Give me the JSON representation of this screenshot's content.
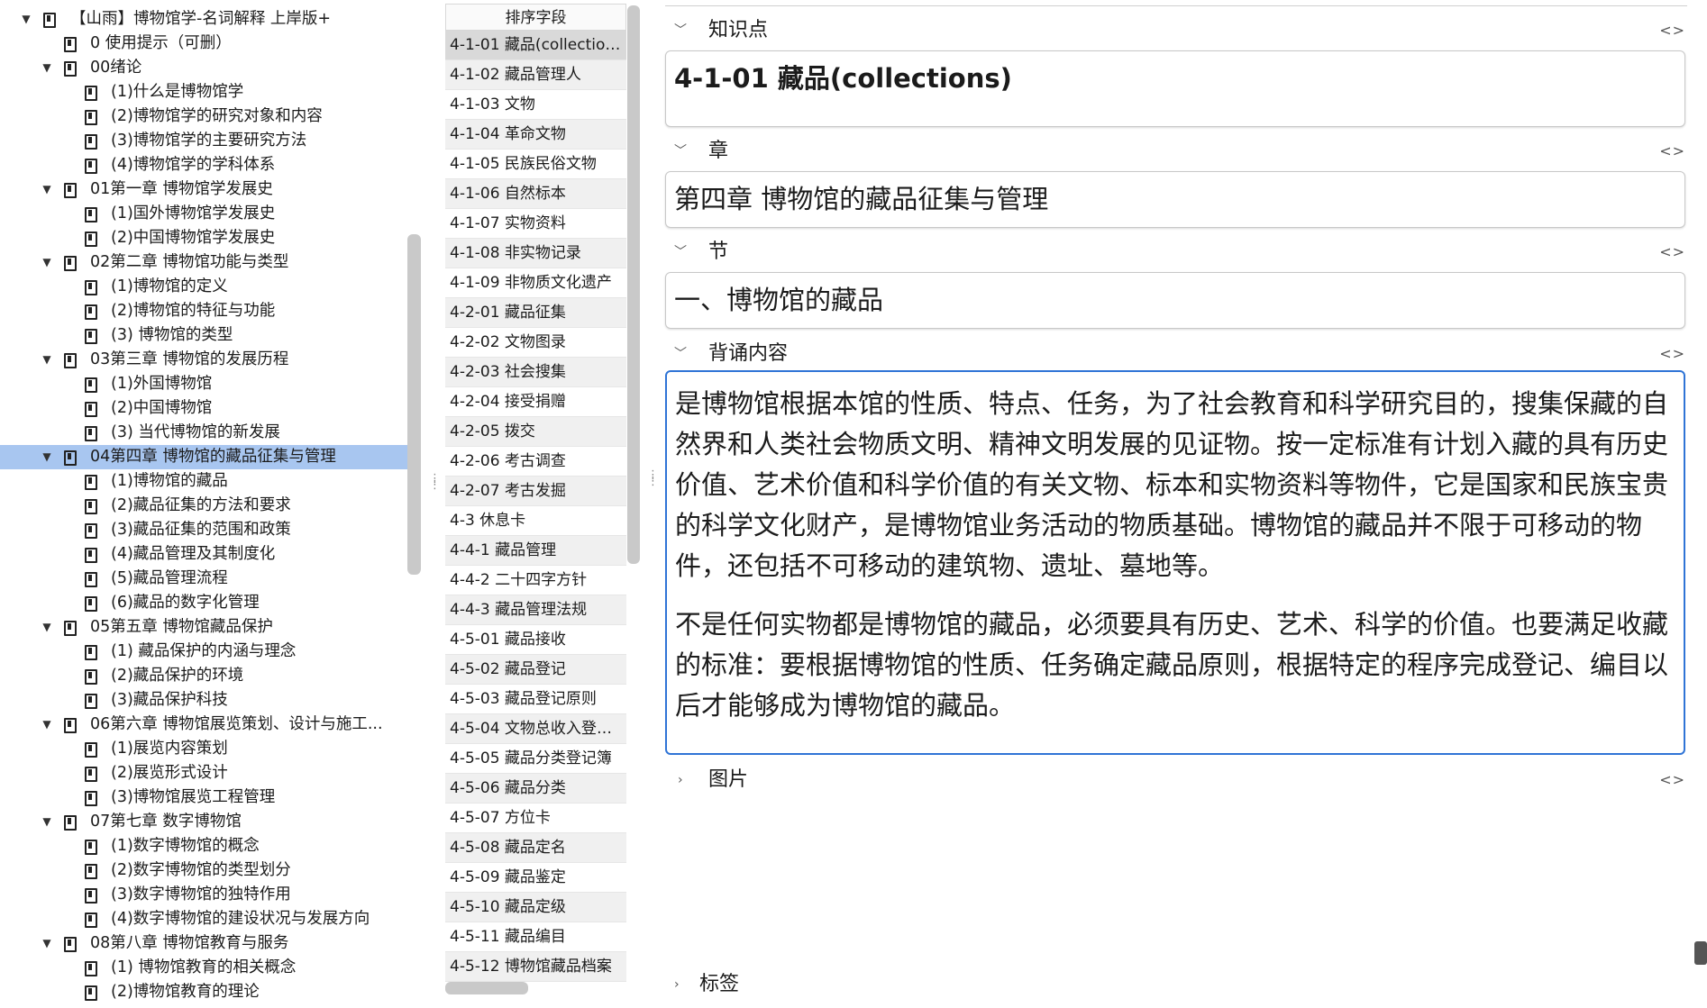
{
  "tree": {
    "items": [
      {
        "label": "【山雨】博物馆学-名词解释 上岸版+",
        "level": 0,
        "expanded": true,
        "selected": false
      },
      {
        "label": "0 使用提示（可删）",
        "level": 2,
        "expanded": null,
        "selected": false,
        "indent": 1
      },
      {
        "label": "00绪论",
        "level": 1,
        "expanded": true,
        "selected": false
      },
      {
        "label": "(1)什么是博物馆学",
        "level": 2,
        "expanded": null,
        "selected": false
      },
      {
        "label": "(2)博物馆学的研究对象和内容",
        "level": 2,
        "expanded": null,
        "selected": false
      },
      {
        "label": "(3)博物馆学的主要研究方法",
        "level": 2,
        "expanded": null,
        "selected": false
      },
      {
        "label": "(4)博物馆学的学科体系",
        "level": 2,
        "expanded": null,
        "selected": false
      },
      {
        "label": "01第一章 博物馆学发展史",
        "level": 1,
        "expanded": true,
        "selected": false
      },
      {
        "label": "(1)国外博物馆学发展史",
        "level": 2,
        "expanded": null,
        "selected": false
      },
      {
        "label": "(2)中国博物馆学发展史",
        "level": 2,
        "expanded": null,
        "selected": false
      },
      {
        "label": "02第二章 博物馆功能与类型",
        "level": 1,
        "expanded": true,
        "selected": false
      },
      {
        "label": "(1)博物馆的定义",
        "level": 2,
        "expanded": null,
        "selected": false
      },
      {
        "label": "(2)博物馆的特征与功能",
        "level": 2,
        "expanded": null,
        "selected": false
      },
      {
        "label": "(3) 博物馆的类型",
        "level": 2,
        "expanded": null,
        "selected": false
      },
      {
        "label": "03第三章 博物馆的发展历程",
        "level": 1,
        "expanded": true,
        "selected": false
      },
      {
        "label": "(1)外国博物馆",
        "level": 2,
        "expanded": null,
        "selected": false
      },
      {
        "label": "(2)中国博物馆",
        "level": 2,
        "expanded": null,
        "selected": false
      },
      {
        "label": "(3) 当代博物馆的新发展",
        "level": 2,
        "expanded": null,
        "selected": false
      },
      {
        "label": "04第四章 博物馆的藏品征集与管理",
        "level": 1,
        "expanded": true,
        "selected": true
      },
      {
        "label": "(1)博物馆的藏品",
        "level": 2,
        "expanded": null,
        "selected": false
      },
      {
        "label": "(2)藏品征集的方法和要求",
        "level": 2,
        "expanded": null,
        "selected": false
      },
      {
        "label": "(3)藏品征集的范围和政策",
        "level": 2,
        "expanded": null,
        "selected": false
      },
      {
        "label": "(4)藏品管理及其制度化",
        "level": 2,
        "expanded": null,
        "selected": false
      },
      {
        "label": "(5)藏品管理流程",
        "level": 2,
        "expanded": null,
        "selected": false
      },
      {
        "label": "(6)藏品的数字化管理",
        "level": 2,
        "expanded": null,
        "selected": false
      },
      {
        "label": "05第五章 博物馆藏品保护",
        "level": 1,
        "expanded": true,
        "selected": false
      },
      {
        "label": "(1) 藏品保护的内涵与理念",
        "level": 2,
        "expanded": null,
        "selected": false
      },
      {
        "label": "(2)藏品保护的环境",
        "level": 2,
        "expanded": null,
        "selected": false
      },
      {
        "label": "(3)藏品保护科技",
        "level": 2,
        "expanded": null,
        "selected": false
      },
      {
        "label": "06第六章 博物馆展览策划、设计与施工...",
        "level": 1,
        "expanded": true,
        "selected": false
      },
      {
        "label": "(1)展览内容策划",
        "level": 2,
        "expanded": null,
        "selected": false
      },
      {
        "label": "(2)展览形式设计",
        "level": 2,
        "expanded": null,
        "selected": false
      },
      {
        "label": "(3)博物馆展览工程管理",
        "level": 2,
        "expanded": null,
        "selected": false
      },
      {
        "label": "07第七章 数字博物馆",
        "level": 1,
        "expanded": true,
        "selected": false
      },
      {
        "label": "(1)数字博物馆的概念",
        "level": 2,
        "expanded": null,
        "selected": false
      },
      {
        "label": "(2)数字博物馆的类型划分",
        "level": 2,
        "expanded": null,
        "selected": false
      },
      {
        "label": "(3)数字博物馆的独特作用",
        "level": 2,
        "expanded": null,
        "selected": false
      },
      {
        "label": "(4)数字博物馆的建设状况与发展方向",
        "level": 2,
        "expanded": null,
        "selected": false
      },
      {
        "label": "08第八章 博物馆教育与服务",
        "level": 1,
        "expanded": true,
        "selected": false
      },
      {
        "label": "(1) 博物馆教育的相关概念",
        "level": 2,
        "expanded": null,
        "selected": false
      },
      {
        "label": "(2)博物馆教育的理论",
        "level": 2,
        "expanded": null,
        "selected": false
      }
    ]
  },
  "cards": {
    "header": "排序字段",
    "rows": [
      "4-1-01 藏品(collections)",
      "4-1-02 藏品管理人",
      "4-1-03 文物",
      "4-1-04 革命文物",
      "4-1-05 民族民俗文物",
      "4-1-06 自然标本",
      "4-1-07 实物资料",
      "4-1-08 非实物记录",
      "4-1-09 非物质文化遗产",
      "4-2-01 藏品征集",
      "4-2-02 文物图录",
      "4-2-03 社会搜集",
      "4-2-04 接受捐赠",
      "4-2-05 拨交",
      "4-2-06 考古调查",
      "4-2-07 考古发掘",
      "4-3 休息卡",
      "4-4-1 藏品管理",
      "4-4-2 二十四字方针",
      "4-4-3 藏品管理法规",
      "4-5-01 藏品接收",
      "4-5-02 藏品登记",
      "4-5-03 藏品登记原则",
      "4-5-04 文物总收入登记...",
      "4-5-05 藏品分类登记簿",
      "4-5-06 藏品分类",
      "4-5-07 方位卡",
      "4-5-08 藏品定名",
      "4-5-09 藏品鉴定",
      "4-5-10 藏品定级",
      "4-5-11 藏品编目",
      "4-5-12 博物馆藏品档案"
    ],
    "selected_index": 0
  },
  "editor": {
    "code_toggle": "<>",
    "fields": {
      "knowledge": {
        "name": "知识点",
        "value": "4-1-01 藏品(collections)"
      },
      "chapter": {
        "name": "章",
        "value": "第四章 博物馆的藏品征集与管理"
      },
      "section": {
        "name": "节",
        "value": "一、博物馆的藏品"
      },
      "content": {
        "name": "背诵内容",
        "paragraphs": [
          "是博物馆根据本馆的性质、特点、任务，为了社会教育和科学研究目的，搜集保藏的自然界和人类社会物质文明、精神文明发展的见证物。按一定标准有计划入藏的具有历史价值、艺术价值和科学价值的有关文物、标本和实物资料等物件，它是国家和民族宝贵的科学文化财产，是博物馆业务活动的物质基础。博物馆的藏品并不限于可移动的物件，还包括不可移动的建筑物、遗址、墓地等。",
          "不是任何实物都是博物馆的藏品，必须要具有历史、艺术、科学的价值。也要满足收藏的标准：要根据博物馆的性质、任务确定藏品原则，根据特定的程序完成登记、编目以后才能够成为博物馆的藏品。"
        ]
      },
      "images": {
        "name": "图片"
      },
      "tags": {
        "name": "标签"
      }
    }
  },
  "icons": {
    "expanded": "chevron-down-icon",
    "collapsed": "chevron-right-icon",
    "deck": "deck-icon",
    "splitter": "splitter-handle-icon"
  },
  "colors": {
    "selection": "#a8c6f0",
    "focus_border": "#2f74d6"
  }
}
